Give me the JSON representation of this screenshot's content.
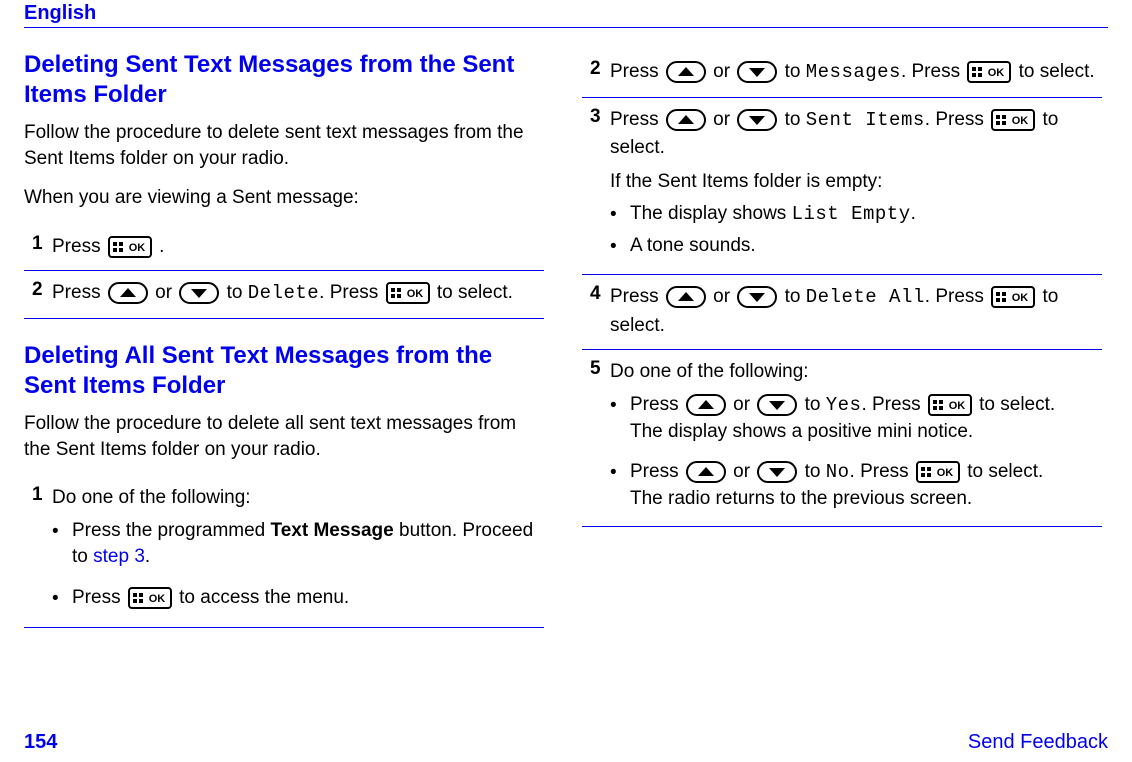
{
  "header": {
    "language": "English"
  },
  "left": {
    "sectionA": {
      "title": "Deleting Sent Text Messages from the Sent Items Folder",
      "intro": "Follow the procedure to delete sent text messages from the Sent Items folder on your radio.",
      "preface": "When you are viewing a Sent message:",
      "step1": {
        "num": "1",
        "text1": "Press ",
        "text2": " ."
      },
      "step2": {
        "num": "2",
        "text1": "Press ",
        "or": " or ",
        "to": " to ",
        "target": "Delete",
        "text2": ". Press ",
        "text3": " to select."
      }
    },
    "sectionB": {
      "title": "Deleting All Sent Text Messages from the Sent Items Folder",
      "intro": "Follow the procedure to delete all sent text messages from the Sent Items folder on your radio.",
      "step1": {
        "num": "1",
        "text": "Do one of the following:",
        "bullet1a": "Press the programmed ",
        "bullet1b": "Text Message",
        "bullet1c": " button. Proceed to ",
        "bullet1d": "step 3",
        "bullet1e": ".",
        "bullet2a": "Press ",
        "bullet2b": " to access the menu."
      }
    }
  },
  "right": {
    "step2": {
      "num": "2",
      "t1": "Press ",
      "or": " or ",
      "to": " to ",
      "target": "Messages",
      "t2": ". Press ",
      "t3": " to select."
    },
    "step3": {
      "num": "3",
      "t1": "Press ",
      "or": " or ",
      "to": " to ",
      "target": "Sent Items",
      "t2": ". Press ",
      "t3": " to select.",
      "sub": "If the Sent Items folder is empty:",
      "b1a": "The display shows ",
      "b1b": "List Empty",
      "b1c": ".",
      "b2": "A tone sounds."
    },
    "step4": {
      "num": "4",
      "t1": "Press ",
      "or": " or ",
      "to": " to ",
      "target": "Delete All",
      "t2": ". Press ",
      "t3": " to select."
    },
    "step5": {
      "num": "5",
      "text": "Do one of the following:",
      "b1": {
        "t1": "Press ",
        "or": " or ",
        "to": " to ",
        "target": "Yes",
        "t2": ". Press ",
        "t3": " to select.",
        "line2": "The display shows a positive mini notice."
      },
      "b2": {
        "t1": "Press ",
        "or": " or ",
        "to": " to ",
        "target": "No",
        "t2": ". Press ",
        "t3": " to select.",
        "line2": "The radio returns to the previous screen."
      }
    }
  },
  "footer": {
    "page": "154",
    "feedback": "Send Feedback"
  }
}
